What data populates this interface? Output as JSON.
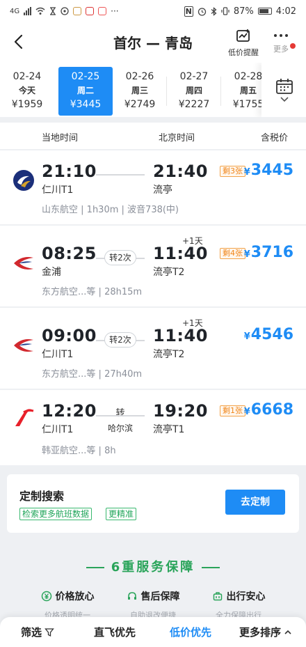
{
  "status_bar": {
    "signal_text": "4G",
    "battery": "87%",
    "time": "4:02"
  },
  "header": {
    "title": "首尔 — 青岛",
    "price_alert_label": "低价提醒",
    "more_label": "更多"
  },
  "dates": [
    {
      "date": "02-24",
      "weekday": "今天",
      "price": "¥1959",
      "selected": false
    },
    {
      "date": "02-25",
      "weekday": "周二",
      "price": "¥3445",
      "selected": true
    },
    {
      "date": "02-26",
      "weekday": "周三",
      "price": "¥2749",
      "selected": false
    },
    {
      "date": "02-27",
      "weekday": "周四",
      "price": "¥2227",
      "selected": false
    },
    {
      "date": "02-28",
      "weekday": "周五",
      "price": "¥1755",
      "selected": false
    }
  ],
  "columns": {
    "local_time": "当地时间",
    "beijing_time": "北京时间",
    "tax_included": "含税价"
  },
  "flights": [
    {
      "airline_logo": "shandong-airlines-logo",
      "dep_time": "21:10",
      "dep_airport": "仁川T1",
      "arr_time": "21:40",
      "arr_airport": "流亭",
      "stop": "",
      "stop_city": "",
      "plus_day": "",
      "remaining": "剩3张",
      "currency": "¥",
      "price": "3445",
      "airline": "山东航空",
      "duration": "1h30m",
      "aircraft": "波音738(中)"
    },
    {
      "airline_logo": "china-eastern-logo",
      "dep_time": "08:25",
      "dep_airport": "金浦",
      "arr_time": "11:40",
      "arr_airport": "流亭T2",
      "stop": "转2次",
      "stop_city": "",
      "plus_day": "+1天",
      "remaining": "剩4张",
      "currency": "¥",
      "price": "3716",
      "airline": "东方航空...等",
      "duration": "28h15m",
      "aircraft": ""
    },
    {
      "airline_logo": "china-eastern-logo",
      "dep_time": "09:00",
      "dep_airport": "仁川T1",
      "arr_time": "11:40",
      "arr_airport": "流亭T2",
      "stop": "转2次",
      "stop_city": "",
      "plus_day": "+1天",
      "remaining": "",
      "currency": "¥",
      "price": "4546",
      "airline": "东方航空...等",
      "duration": "27h40m",
      "aircraft": ""
    },
    {
      "airline_logo": "korean-air-logo",
      "dep_time": "12:20",
      "dep_airport": "仁川T1",
      "arr_time": "19:20",
      "arr_airport": "流亭T1",
      "stop": "转",
      "stop_city": "哈尔滨",
      "plus_day": "",
      "remaining": "剩1张",
      "currency": "¥",
      "price": "6668",
      "airline": "韩亚航空...等",
      "duration": "8h",
      "aircraft": ""
    }
  ],
  "custom_search": {
    "title": "定制搜索",
    "tag1": "检索更多航班数据",
    "tag2": "更精准",
    "button": "去定制"
  },
  "guarantee": {
    "title": "6重服务保障",
    "items": [
      {
        "icon": "yuan-icon",
        "title": "价格放心",
        "subtitle": "价格透明统一"
      },
      {
        "icon": "headset-icon",
        "title": "售后保障",
        "subtitle": "自助退改便捷"
      },
      {
        "icon": "suitcase-icon",
        "title": "出行安心",
        "subtitle": "全力保障出行"
      }
    ]
  },
  "bottom_bar": {
    "filter": "筛选",
    "direct_first": "直飞优先",
    "low_price_first": "低价优先",
    "more_sort": "更多排序"
  },
  "colors": {
    "accent": "#1e8cf5",
    "remaining_orange": "#f08519",
    "guarantee_green": "#2aa45a"
  }
}
